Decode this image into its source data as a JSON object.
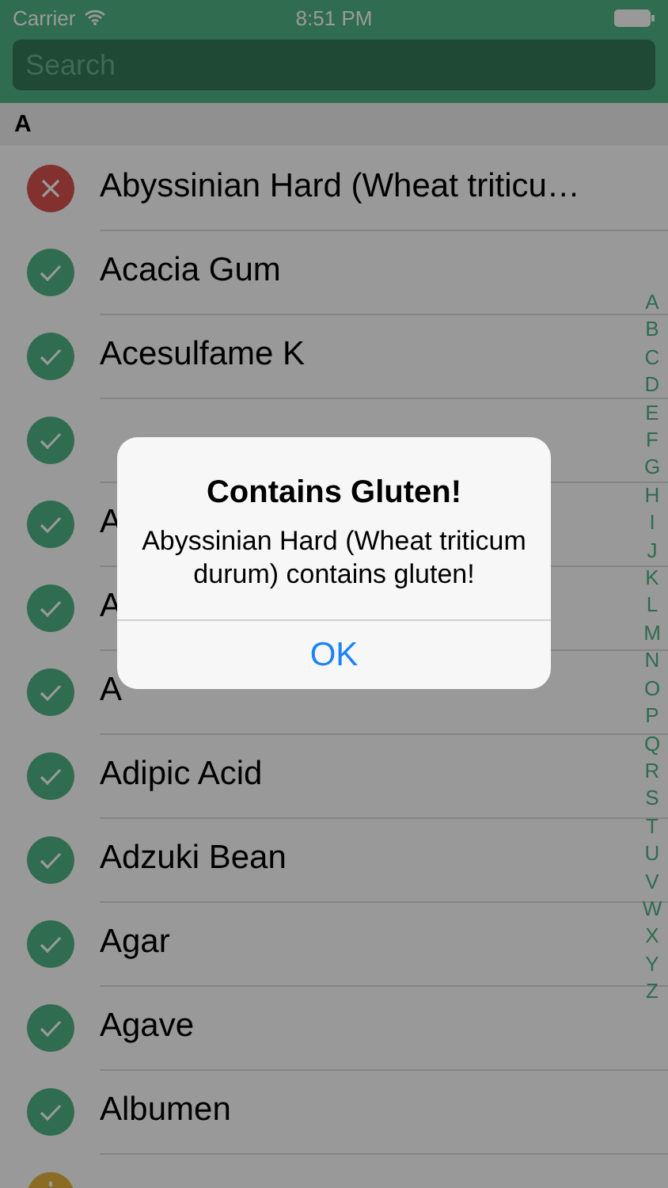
{
  "status_bar": {
    "carrier": "Carrier",
    "time": "8:51 PM"
  },
  "search": {
    "placeholder": "Search"
  },
  "section": "A",
  "rows": [
    {
      "name": "Abyssinian Hard (Wheat triticu…",
      "kind": "gluten"
    },
    {
      "name": "Acacia Gum",
      "kind": "safe"
    },
    {
      "name": "Acesulfame K",
      "kind": "safe"
    },
    {
      "kind": "safe"
    },
    {
      "name": "A",
      "kind": "safe"
    },
    {
      "name": "A",
      "kind": "safe"
    },
    {
      "name": "A",
      "kind": "safe"
    },
    {
      "name": "Adipic Acid",
      "kind": "safe"
    },
    {
      "name": "Adzuki Bean",
      "kind": "safe"
    },
    {
      "name": "Agar",
      "kind": "safe"
    },
    {
      "name": "Agave",
      "kind": "safe"
    },
    {
      "name": "Albumen",
      "kind": "safe"
    },
    {
      "kind": "caution"
    }
  ],
  "index": [
    "A",
    "B",
    "C",
    "D",
    "E",
    "F",
    "G",
    "H",
    "I",
    "J",
    "K",
    "L",
    "M",
    "N",
    "O",
    "P",
    "Q",
    "R",
    "S",
    "T",
    "U",
    "V",
    "W",
    "X",
    "Y",
    "Z"
  ],
  "alert": {
    "title": "Contains Gluten!",
    "message": "Abyssinian Hard (Wheat triticum durum) contains gluten!",
    "button": "OK"
  }
}
